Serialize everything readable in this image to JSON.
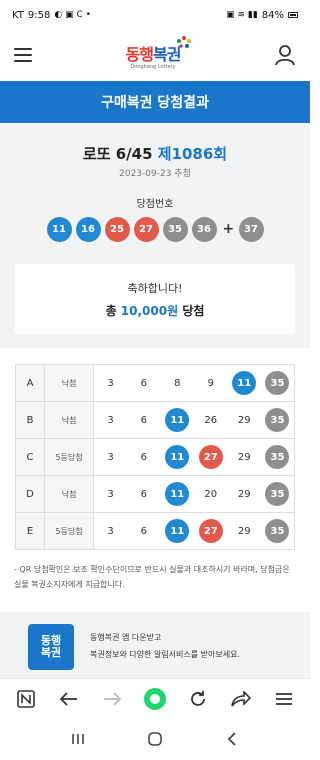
{
  "status": {
    "carrier": "KT",
    "time": "9:58",
    "battery": "84%"
  },
  "header": {
    "logo_text_red": "동행",
    "logo_text_blue": "복권",
    "logo_sub": "Donghang Lottery"
  },
  "page_title": "구매복권 당첨결과",
  "result": {
    "game": "로또 6/45",
    "round": "제1086회",
    "draw_date": "2023-09-23 추첨",
    "winning_label": "당첨번호",
    "winning_numbers": [
      {
        "n": "11",
        "color": "#2189d4"
      },
      {
        "n": "16",
        "color": "#2189d4"
      },
      {
        "n": "25",
        "color": "#e35a4b"
      },
      {
        "n": "27",
        "color": "#e35a4b"
      },
      {
        "n": "35",
        "color": "#8f8f8f"
      },
      {
        "n": "36",
        "color": "#8f8f8f"
      }
    ],
    "plus": "+",
    "bonus": {
      "n": "37",
      "color": "#8f8f8f"
    },
    "congrats": "축하합니다!",
    "total_prefix": "총",
    "total_amount": "10,000원",
    "total_suffix": "당첨"
  },
  "tickets": [
    {
      "letter": "A",
      "result": "낙첨",
      "nums": [
        {
          "n": "3",
          "hit": false
        },
        {
          "n": "6",
          "hit": false
        },
        {
          "n": "8",
          "hit": false
        },
        {
          "n": "9",
          "hit": false
        },
        {
          "n": "11",
          "hit": true,
          "color": "#2189d4"
        },
        {
          "n": "35",
          "hit": true,
          "color": "#8f8f8f"
        }
      ]
    },
    {
      "letter": "B",
      "result": "낙첨",
      "nums": [
        {
          "n": "3",
          "hit": false
        },
        {
          "n": "6",
          "hit": false
        },
        {
          "n": "11",
          "hit": true,
          "color": "#2189d4"
        },
        {
          "n": "26",
          "hit": false
        },
        {
          "n": "29",
          "hit": false
        },
        {
          "n": "35",
          "hit": true,
          "color": "#8f8f8f"
        }
      ]
    },
    {
      "letter": "C",
      "result": "5등당첨",
      "nums": [
        {
          "n": "3",
          "hit": false
        },
        {
          "n": "6",
          "hit": false
        },
        {
          "n": "11",
          "hit": true,
          "color": "#2189d4"
        },
        {
          "n": "27",
          "hit": true,
          "color": "#e35a4b"
        },
        {
          "n": "29",
          "hit": false
        },
        {
          "n": "35",
          "hit": true,
          "color": "#8f8f8f"
        }
      ]
    },
    {
      "letter": "D",
      "result": "낙첨",
      "nums": [
        {
          "n": "3",
          "hit": false
        },
        {
          "n": "6",
          "hit": false
        },
        {
          "n": "11",
          "hit": true,
          "color": "#2189d4"
        },
        {
          "n": "20",
          "hit": false
        },
        {
          "n": "29",
          "hit": false
        },
        {
          "n": "35",
          "hit": true,
          "color": "#8f8f8f"
        }
      ]
    },
    {
      "letter": "E",
      "result": "5등당첨",
      "nums": [
        {
          "n": "3",
          "hit": false
        },
        {
          "n": "6",
          "hit": false
        },
        {
          "n": "11",
          "hit": true,
          "color": "#2189d4"
        },
        {
          "n": "27",
          "hit": true,
          "color": "#e35a4b"
        },
        {
          "n": "29",
          "hit": false
        },
        {
          "n": "35",
          "hit": true,
          "color": "#8f8f8f"
        }
      ]
    }
  ],
  "note": "- QR 당첨확인은 보조 확인수단이므로 반드시 실물과 대조하시기 바라며, 당첨금은 실물 복권소지자에게 지급합니다.",
  "banner": {
    "icon_line1": "동행",
    "icon_line2": "복권",
    "line1": "동행복권 앱 다운받고",
    "line2": "복권정보와 다양한 알림서비스를 받아보세요."
  },
  "icons": {
    "hamburger": "hamburger-icon",
    "user": "person-icon",
    "browser": [
      "n-logo-icon",
      "back-arrow-icon",
      "forward-arrow-icon",
      "home-circle-icon",
      "reload-icon",
      "share-icon",
      "menu-icon"
    ],
    "nav": [
      "recent-apps-icon",
      "home-icon",
      "back-icon"
    ]
  },
  "colors": {
    "primary": "#1976c8",
    "ball_blue": "#2189d4",
    "ball_red": "#e35a4b",
    "ball_gray": "#8f8f8f"
  }
}
